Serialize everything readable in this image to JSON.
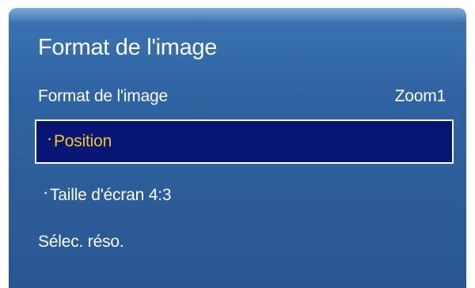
{
  "menu": {
    "title": "Format de l'image",
    "items": [
      {
        "label": "Format de l'image",
        "value": "Zoom1"
      },
      {
        "label": "Position",
        "prefix": "·",
        "selected": true
      },
      {
        "label": "Taille d'écran 4:3",
        "prefix": "·"
      },
      {
        "label": "Sélec. réso."
      }
    ]
  },
  "colors": {
    "panel_top": "#4f8ac7",
    "panel_bottom": "#285791",
    "highlight_bg": "#061672",
    "highlight_text": "#f2c233",
    "text": "#ffffff"
  }
}
